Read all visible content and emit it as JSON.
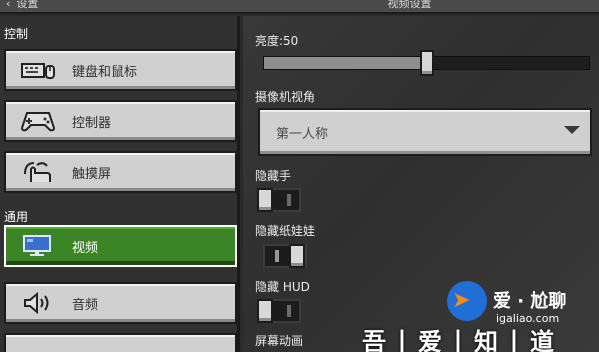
{
  "topbar": {
    "back_label": "设置",
    "title": "视频设置"
  },
  "sidebar": {
    "section_control": "控制",
    "section_general": "通用",
    "items": [
      {
        "label": "键盘和鼠标",
        "icon": "keyboard-mouse-icon"
      },
      {
        "label": "控制器",
        "icon": "gamepad-icon"
      },
      {
        "label": "触摸屏",
        "icon": "touch-hand-icon"
      },
      {
        "label": "视频",
        "icon": "monitor-icon",
        "active": true
      },
      {
        "label": "音频",
        "icon": "speaker-icon"
      }
    ]
  },
  "main": {
    "brightness_label": "亮度:50",
    "brightness_value": 50,
    "camera_label": "摄像机视角",
    "camera_value": "第一人称",
    "hide_hand_label": "隐藏手",
    "hide_hand_on": false,
    "hide_paperdoll_label": "隐藏纸娃娃",
    "hide_paperdoll_on": true,
    "hide_hud_label": "隐藏 HUD",
    "hide_hud_on": false,
    "screen_anim_label": "屏幕动画"
  },
  "watermark": {
    "line1": "爱 · 尬聊",
    "line2": "igaliao.com",
    "banner": "吾丨爱丨知丨道"
  },
  "colors": {
    "active_green": "#3c8527",
    "button_gray": "#d0d0d0"
  }
}
